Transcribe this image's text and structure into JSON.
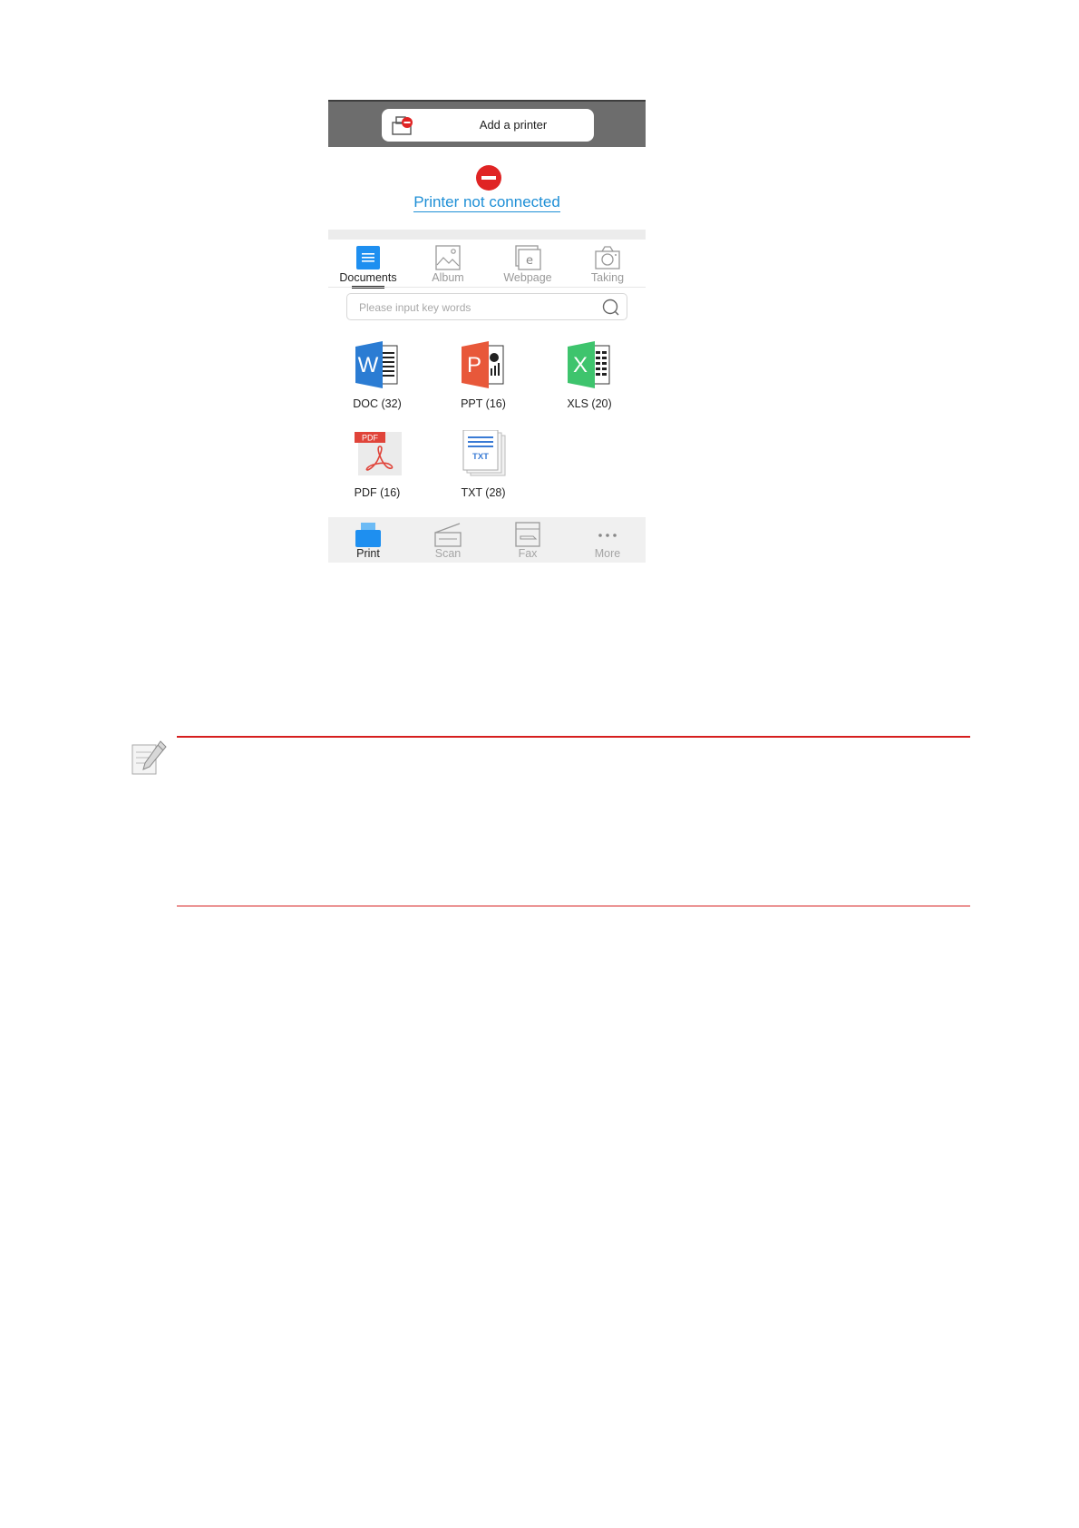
{
  "header": {
    "add_printer_label": "Add a printer"
  },
  "status": {
    "text": "Printer not connected",
    "color": "#1e8fd6"
  },
  "tabs": [
    {
      "label": "Documents",
      "icon": "documents-icon",
      "active": true
    },
    {
      "label": "Album",
      "icon": "album-icon",
      "active": false
    },
    {
      "label": "Webpage",
      "icon": "webpage-icon",
      "active": false
    },
    {
      "label": "Taking",
      "icon": "camera-icon",
      "active": false
    }
  ],
  "search": {
    "placeholder": "Please input key words",
    "icon": "search-icon"
  },
  "files": [
    {
      "label": "DOC (32)",
      "icon": "word-icon"
    },
    {
      "label": "PPT (16)",
      "icon": "powerpoint-icon"
    },
    {
      "label": "XLS (20)",
      "icon": "excel-icon"
    },
    {
      "label": "PDF (16)",
      "icon": "pdf-icon"
    },
    {
      "label": "TXT (28)",
      "icon": "txt-icon"
    }
  ],
  "bottom_nav": [
    {
      "label": "Print",
      "icon": "print-icon",
      "active": true
    },
    {
      "label": "Scan",
      "icon": "scan-icon",
      "active": false
    },
    {
      "label": "Fax",
      "icon": "fax-icon",
      "active": false
    },
    {
      "label": "More",
      "icon": "more-icon",
      "active": false
    }
  ],
  "colors": {
    "accent": "#1e8fd6",
    "note_rule": "#d61e1e",
    "error": "#e02424"
  }
}
